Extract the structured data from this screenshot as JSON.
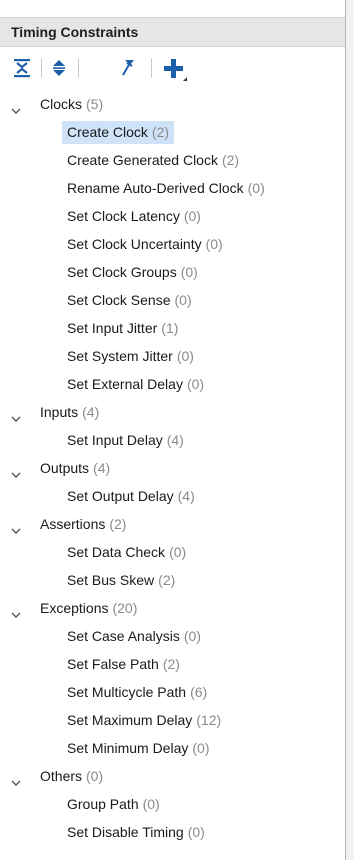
{
  "panel": {
    "title": "Timing Constraints"
  },
  "toolbar": {
    "buttons": [
      {
        "name": "collapse-all",
        "tooltip": "Collapse All"
      },
      {
        "name": "expand-all",
        "tooltip": "Expand All"
      },
      {
        "name": "pin",
        "tooltip": "Pin"
      },
      {
        "name": "add",
        "tooltip": "Add Constraint"
      }
    ],
    "colors": {
      "icon": "#1d5fa8",
      "pin": "#1d5fa8"
    }
  },
  "tree": {
    "categories": [
      {
        "label": "Clocks",
        "count": "(5)",
        "expanded": true,
        "children": [
          {
            "label": "Create Clock",
            "count": "(2)",
            "selected": true
          },
          {
            "label": "Create Generated Clock",
            "count": "(2)"
          },
          {
            "label": "Rename Auto-Derived Clock",
            "count": "(0)"
          },
          {
            "label": "Set Clock Latency",
            "count": "(0)"
          },
          {
            "label": "Set Clock Uncertainty",
            "count": "(0)"
          },
          {
            "label": "Set Clock Groups",
            "count": "(0)"
          },
          {
            "label": "Set Clock Sense",
            "count": "(0)"
          },
          {
            "label": "Set Input Jitter",
            "count": "(1)"
          },
          {
            "label": "Set System Jitter",
            "count": "(0)"
          },
          {
            "label": "Set External Delay",
            "count": "(0)"
          }
        ]
      },
      {
        "label": "Inputs",
        "count": "(4)",
        "expanded": true,
        "children": [
          {
            "label": "Set Input Delay",
            "count": "(4)"
          }
        ]
      },
      {
        "label": "Outputs",
        "count": "(4)",
        "expanded": true,
        "children": [
          {
            "label": "Set Output Delay",
            "count": "(4)"
          }
        ]
      },
      {
        "label": "Assertions",
        "count": "(2)",
        "expanded": true,
        "children": [
          {
            "label": "Set Data Check",
            "count": "(0)"
          },
          {
            "label": "Set Bus Skew",
            "count": "(2)"
          }
        ]
      },
      {
        "label": "Exceptions",
        "count": "(20)",
        "expanded": true,
        "children": [
          {
            "label": "Set Case Analysis",
            "count": "(0)"
          },
          {
            "label": "Set False Path",
            "count": "(2)"
          },
          {
            "label": "Set Multicycle Path",
            "count": "(6)"
          },
          {
            "label": "Set Maximum Delay",
            "count": "(12)"
          },
          {
            "label": "Set Minimum Delay",
            "count": "(0)"
          }
        ]
      },
      {
        "label": "Others",
        "count": "(0)",
        "expanded": true,
        "children": [
          {
            "label": "Group Path",
            "count": "(0)"
          },
          {
            "label": "Set Disable Timing",
            "count": "(0)"
          }
        ]
      }
    ],
    "colors": {
      "selection": "#cfe2f8",
      "count": "#8a8a8a"
    }
  }
}
